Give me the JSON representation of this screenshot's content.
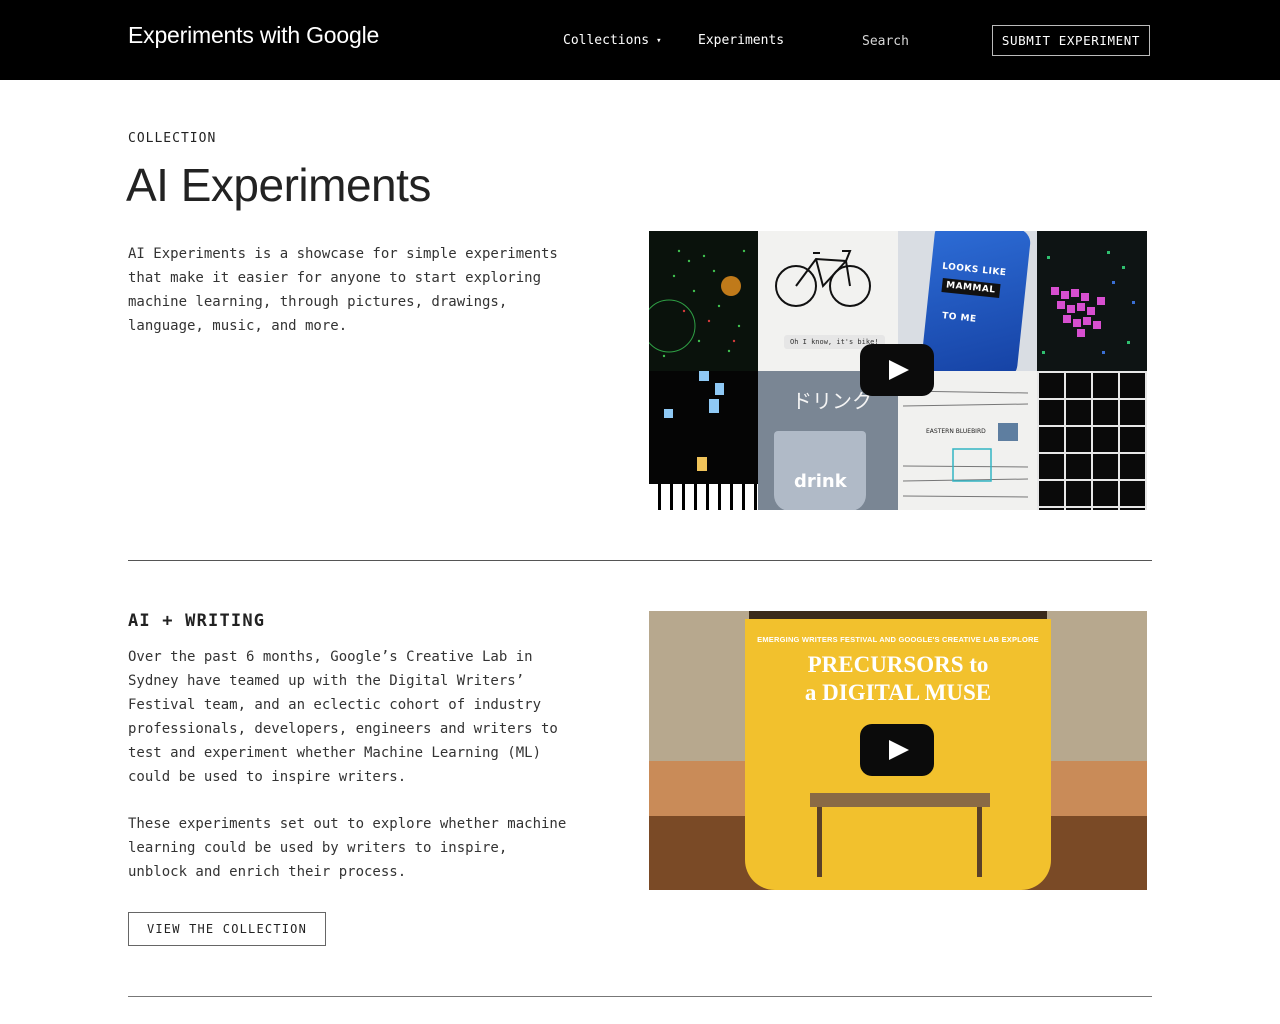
{
  "header": {
    "brand": "Experiments with Google",
    "nav_collections": "Collections",
    "nav_caret": "▾",
    "nav_experiments": "Experiments",
    "search_placeholder": "Search",
    "submit_label": "SUBMIT EXPERIMENT"
  },
  "collection": {
    "eyebrow": "COLLECTION",
    "title": "AI Experiments",
    "description": "AI Experiments is a showcase for simple experiments that make it easier for anyone to start exploring machine learning, through pictures, drawings, language, music, and more.",
    "video_thumbnail_text": {
      "bike_caption": "Oh I know, it's bike!",
      "phone_line1": "LOOKS LIKE",
      "phone_line2": "MAMMAL",
      "phone_line3": "TO ME",
      "japanese": "ドリンク",
      "drink": "drink",
      "bird": "EASTERN BLUEBIRD"
    }
  },
  "section": {
    "heading": "AI + WRITING",
    "paragraph1": "Over the past 6 months, Google’s Creative Lab in Sydney have teamed up with the Digital Writers’ Festival team, and an eclectic cohort of industry professionals, developers, engineers and writers to test and experiment whether Machine Learning (ML) could be used to inspire writers.",
    "paragraph2": "These experiments set out to explore whether machine learning could be used by writers to inspire, unblock and enrich their process.",
    "button_label": "VIEW THE COLLECTION",
    "video_small_text": "EMERGING WRITERS FESTIVAL AND GOOGLE'S CREATIVE LAB EXPLORE",
    "video_title_line1": "PRECURSORS to",
    "video_title_line2": "a DIGITAL MUSE"
  },
  "colors": {
    "header_bg": "#000000",
    "poster_yellow": "#f2c12d",
    "phone_blue": "#2e6ed8"
  }
}
